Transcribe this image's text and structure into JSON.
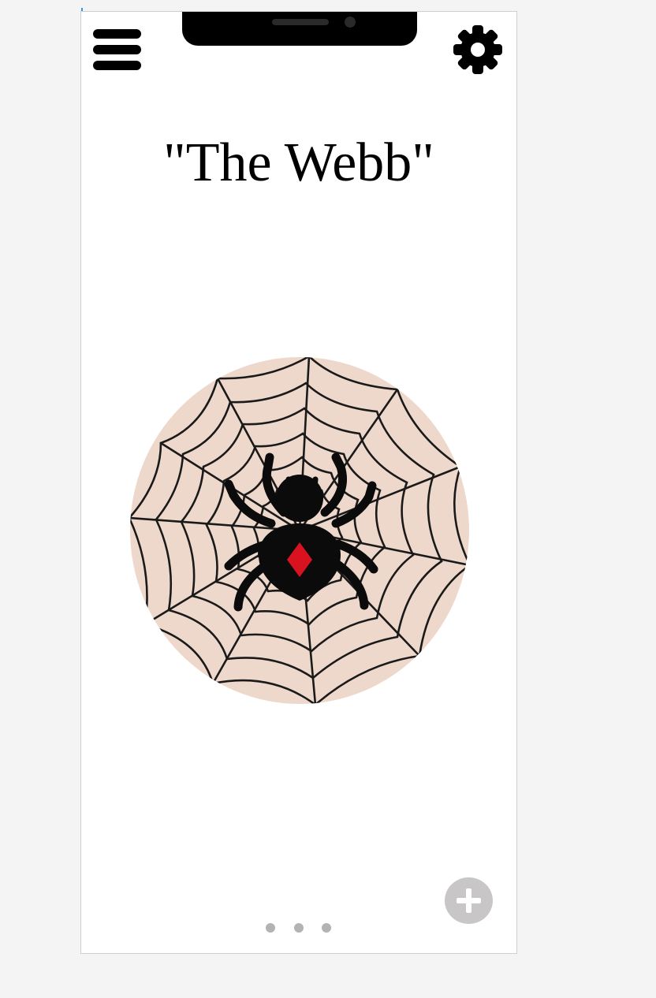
{
  "header": {
    "menu_icon": "hamburger-menu-icon",
    "settings_icon": "gear-icon"
  },
  "main": {
    "title": "\"The Webb\"",
    "hero_image": "spider-on-web-image"
  },
  "footer": {
    "add_icon": "plus-icon",
    "pager": {
      "count": 3
    }
  },
  "colors": {
    "web_background": "#eed8cb",
    "spider_body": "#0b0b0b",
    "spider_marking": "#d8121f",
    "add_button": "#c8c6c6",
    "pager_dot": "#b3b3b3"
  }
}
